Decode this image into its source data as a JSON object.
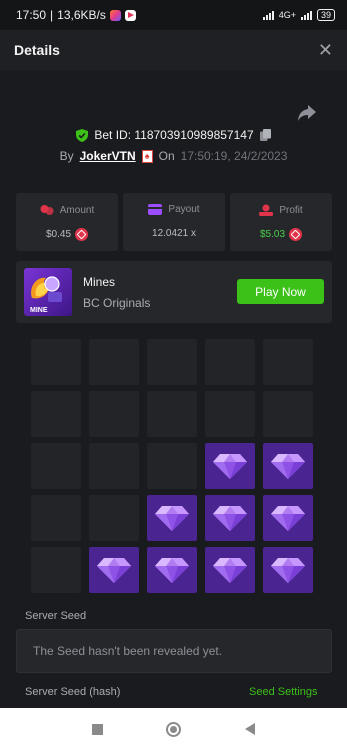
{
  "status_bar": {
    "time": "17:50",
    "speed": "13,6KB/s",
    "network": "4G+",
    "battery": "39"
  },
  "header": {
    "title": "Details",
    "close_icon": "close-icon"
  },
  "bet": {
    "id_label": "Bet ID: 118703910989857147",
    "by_label": "By",
    "username": "JokerVTN",
    "on_label": "On",
    "timestamp": "17:50:19, 24/2/2023"
  },
  "stats": {
    "amount": {
      "label": "Amount",
      "value": "$0.45"
    },
    "payout": {
      "label": "Payout",
      "value": "12.0421 x"
    },
    "profit": {
      "label": "Profit",
      "value": "$5.03"
    }
  },
  "game": {
    "name": "Mines",
    "provider": "BC Originals",
    "thumb_text": "MINE",
    "play_label": "Play Now"
  },
  "board": {
    "rows": 5,
    "cols": 5,
    "cells": [
      [
        0,
        0,
        0,
        0,
        0
      ],
      [
        0,
        0,
        0,
        0,
        0
      ],
      [
        0,
        0,
        0,
        1,
        1
      ],
      [
        0,
        0,
        1,
        1,
        1
      ],
      [
        0,
        1,
        1,
        1,
        1
      ]
    ]
  },
  "seed": {
    "server_seed_label": "Server Seed",
    "server_seed_value": "The Seed hasn't been revealed yet.",
    "hash_label": "Server Seed (hash)",
    "settings_label": "Seed Settings"
  },
  "colors": {
    "accent_green": "#3bc117",
    "gem_tile": "#4a2490",
    "trx_red": "#e0344b"
  }
}
